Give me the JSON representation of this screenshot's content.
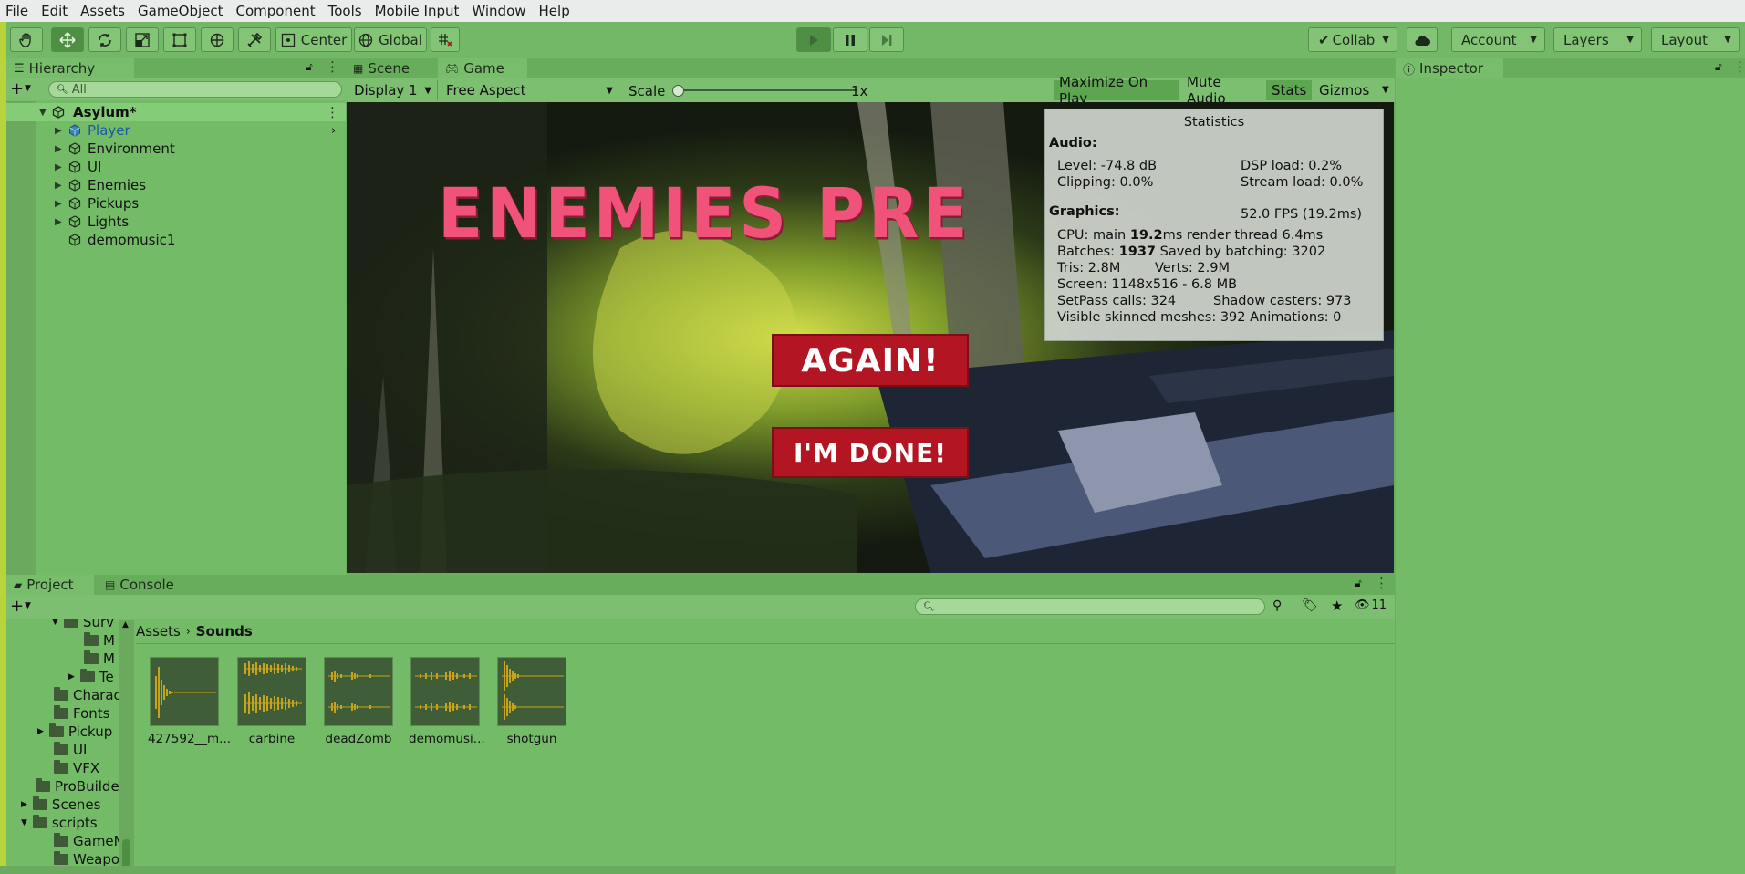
{
  "menu": [
    "File",
    "Edit",
    "Assets",
    "GameObject",
    "Component",
    "Tools",
    "Mobile Input",
    "Window",
    "Help"
  ],
  "toolbar": {
    "tools": [
      "hand-icon",
      "move-icon",
      "rotate-icon",
      "scale-icon",
      "rect-icon",
      "transform-icon",
      "custom-tool-icon"
    ],
    "pivot_label": "Center",
    "space_label": "Global",
    "collab_label": "Collab",
    "account_label": "Account",
    "layers_label": "Layers",
    "layout_label": "Layout"
  },
  "hierarchy": {
    "tab_label": "Hierarchy",
    "search_placeholder": "All",
    "scene_name": "Asylum*",
    "items": [
      "Player",
      "Environment",
      "UI",
      "Enemies",
      "Pickups",
      "Lights",
      "demomusic1"
    ]
  },
  "game": {
    "tabs": [
      "Scene",
      "Game"
    ],
    "display": "Display 1",
    "aspect": "Free Aspect",
    "scale_label": "Scale",
    "scale_value": "1x",
    "buttons": [
      "Maximize On Play",
      "Mute Audio",
      "Stats",
      "Gizmos"
    ],
    "banner_text": "ENEMIES PRE",
    "again_label": "AGAIN!",
    "done_label": "I'M DONE!"
  },
  "stats": {
    "title": "Statistics",
    "audio_hdr": "Audio:",
    "level": "Level: -74.8 dB",
    "dsp": "DSP load: 0.2%",
    "clipping": "Clipping: 0.0%",
    "stream": "Stream load: 0.0%",
    "graphics_hdr": "Graphics:",
    "fps": "52.0 FPS (19.2ms)",
    "cpu_a": "CPU: main ",
    "cpu_b": "19.2",
    "cpu_c": "ms  render thread 6.4ms",
    "batches_a": "Batches: ",
    "batches_b": "1937",
    "batches_c": "  Saved by batching: 3202",
    "tris": "Tris: 2.8M",
    "verts": "Verts: 2.9M",
    "screen": "Screen: 1148x516 - 6.8 MB",
    "setpass": "SetPass calls: 324",
    "shadow": "Shadow casters: 973",
    "skinned": "Visible skinned meshes: 392  Animations: 0"
  },
  "inspector": {
    "tab_label": "Inspector"
  },
  "project": {
    "tabs": [
      "Project",
      "Console"
    ],
    "hidden_count": "11",
    "breadcrumb": [
      "Assets",
      "Sounds"
    ],
    "tree": [
      "Surv",
      "M",
      "M",
      "Te",
      "Charac",
      "Fonts",
      "Pickup",
      "UI",
      "VFX",
      "ProBuilde",
      "Scenes",
      "scripts",
      "GameM",
      "Weapo"
    ],
    "assets": [
      "427592__m...",
      "carbine",
      "deadZomb",
      "demomusi...",
      "shotgun"
    ]
  }
}
